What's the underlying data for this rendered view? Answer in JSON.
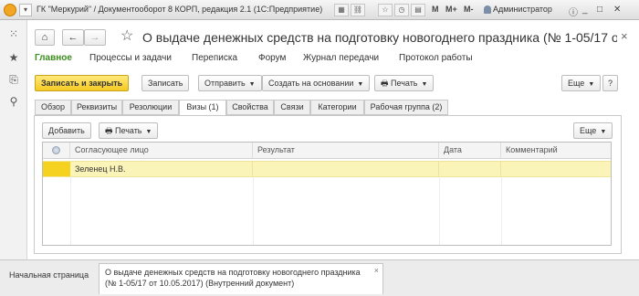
{
  "titlebar": {
    "title": "ГК \"Меркурий\" / Документооборот 8 КОРП, редакция 2.1  (1С:Предприятие)",
    "m_labels": [
      "M",
      "M+",
      "M-"
    ],
    "user": "Администратор"
  },
  "header": {
    "title": "О выдаче денежных средств на подготовку новогоднего праздника (№ 1-05/17 от 1...",
    "close": "×"
  },
  "nav": {
    "items": [
      "Главное",
      "Процессы и задачи",
      "Переписка",
      "Форум",
      "Журнал передачи",
      "Протокол работы"
    ]
  },
  "toolbar": {
    "save_close": "Записать и закрыть",
    "save": "Записать",
    "send": "Отправить",
    "create_basis": "Создать на основании",
    "print": "Печать",
    "help": "?",
    "more": "Еще"
  },
  "tabs": [
    "Обзор",
    "Реквизиты",
    "Резолюции",
    "Визы (1)",
    "Свойства",
    "Связи",
    "Категории",
    "Рабочая группа (2)"
  ],
  "visas": {
    "add": "Добавить",
    "print": "Печать",
    "more": "Еще",
    "columns": [
      "Согласующее лицо",
      "Результат",
      "Дата",
      "Комментарий"
    ],
    "rows": [
      {
        "person": "Зеленец Н.В.",
        "result": "",
        "date": "",
        "comment": ""
      }
    ]
  },
  "taskbar": {
    "home": "Начальная страница",
    "doc_line1": "О выдаче денежных средств на подготовку новогоднего праздника",
    "doc_line2": "(№ 1-05/17 от 10.05.2017) (Внутренний документ)",
    "close": "×"
  }
}
